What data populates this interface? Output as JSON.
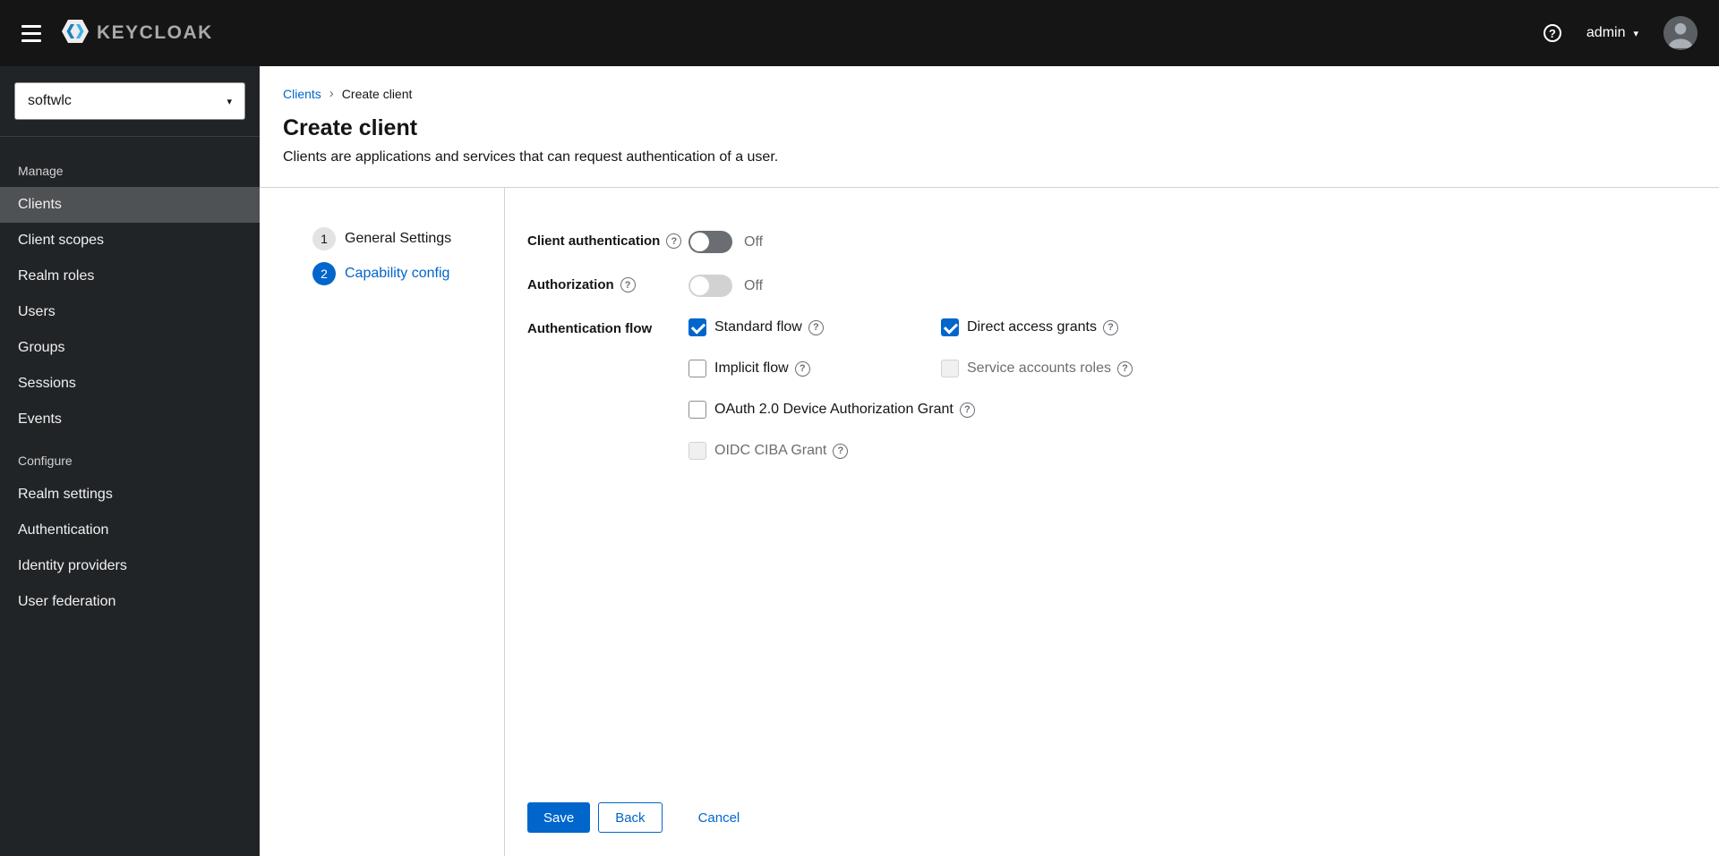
{
  "icons": {
    "help_glyph": "?",
    "caret_down": "▾",
    "breadcrumb_sep": "›"
  },
  "masthead": {
    "brand": "KEYCLOAK",
    "user": "admin"
  },
  "sidebar": {
    "realm_selector": "softwlc",
    "sections": [
      {
        "label": "Manage",
        "items": [
          {
            "label": "Clients",
            "active": true
          },
          {
            "label": "Client scopes",
            "active": false
          },
          {
            "label": "Realm roles",
            "active": false
          },
          {
            "label": "Users",
            "active": false
          },
          {
            "label": "Groups",
            "active": false
          },
          {
            "label": "Sessions",
            "active": false
          },
          {
            "label": "Events",
            "active": false
          }
        ]
      },
      {
        "label": "Configure",
        "items": [
          {
            "label": "Realm settings",
            "active": false
          },
          {
            "label": "Authentication",
            "active": false
          },
          {
            "label": "Identity providers",
            "active": false
          },
          {
            "label": "User federation",
            "active": false
          }
        ]
      }
    ]
  },
  "breadcrumb": {
    "items": [
      "Clients",
      "Create client"
    ]
  },
  "page": {
    "title": "Create client",
    "description": "Clients are applications and services that can request authentication of a user."
  },
  "wizard": {
    "steps": [
      {
        "number": "1",
        "label": "General Settings",
        "current": false
      },
      {
        "number": "2",
        "label": "Capability config",
        "current": true
      }
    ]
  },
  "form": {
    "client_authentication": {
      "label": "Client authentication",
      "state": "Off",
      "enabled": true
    },
    "authorization": {
      "label": "Authorization",
      "state": "Off",
      "enabled": false
    },
    "authentication_flow": {
      "label": "Authentication flow",
      "options": [
        {
          "label": "Standard flow",
          "checked": true,
          "disabled": false
        },
        {
          "label": "Direct access grants",
          "checked": true,
          "disabled": false
        },
        {
          "label": "Implicit flow",
          "checked": false,
          "disabled": false
        },
        {
          "label": "Service accounts roles",
          "checked": false,
          "disabled": true
        },
        {
          "label": "OAuth 2.0 Device Authorization Grant",
          "checked": false,
          "disabled": false
        },
        {
          "label": "OIDC CIBA Grant",
          "checked": false,
          "disabled": true
        }
      ]
    }
  },
  "actions": {
    "save": "Save",
    "back": "Back",
    "cancel": "Cancel"
  }
}
